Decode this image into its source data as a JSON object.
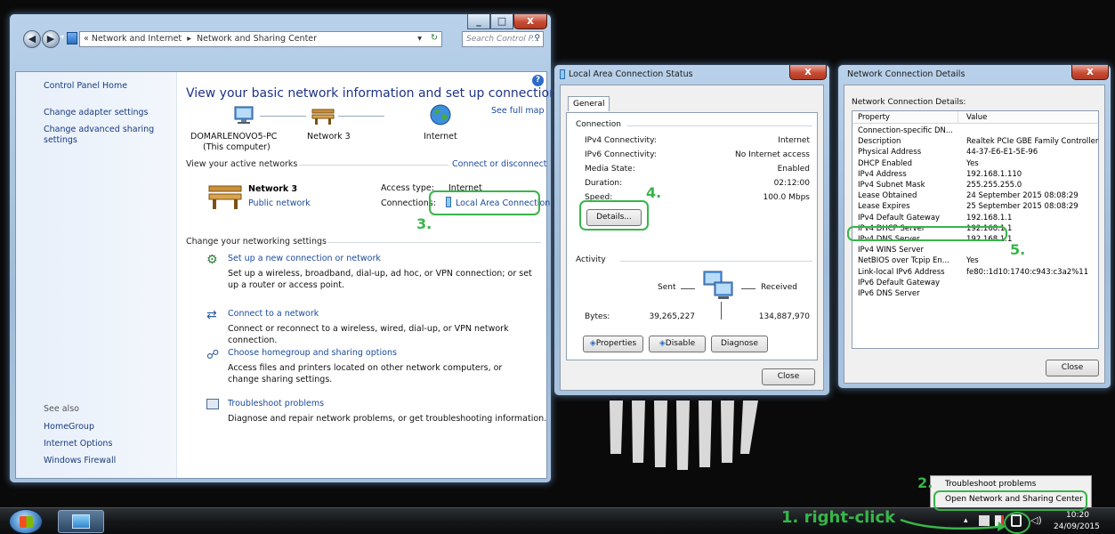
{
  "nsc": {
    "breadcrumb_prefix": "«",
    "crumb_1": "Network and Internet",
    "crumb_sep": "▸",
    "crumb_2": "Network and Sharing Center",
    "search_placeholder": "Search Control P...",
    "sidebar_home": "Control Panel Home",
    "sidebar_links": [
      "Change adapter settings",
      "Change advanced sharing settings"
    ],
    "see_also_label": "See also",
    "see_also_links": [
      "HomeGroup",
      "Internet Options",
      "Windows Firewall"
    ],
    "title": "View your basic network information and set up connections",
    "see_full_map": "See full map",
    "map_computer": "DOMARLENOVO5-PC",
    "map_computer_sub": "(This computer)",
    "map_network": "Network 3",
    "map_internet": "Internet",
    "active_networks_label": "View your active networks",
    "connect_disconnect": "Connect or disconnect",
    "network_name": "Network 3",
    "network_type": "Public network",
    "access_type_label": "Access type:",
    "access_type_value": "Internet",
    "connections_label": "Connections:",
    "connections_value": "Local Area Connection",
    "change_settings_label": "Change your networking settings",
    "tasks": [
      {
        "title": "Set up a new connection or network",
        "desc": "Set up a wireless, broadband, dial-up, ad hoc, or VPN connection; or set up a router or access point."
      },
      {
        "title": "Connect to a network",
        "desc": "Connect or reconnect to a wireless, wired, dial-up, or VPN network connection."
      },
      {
        "title": "Choose homegroup and sharing options",
        "desc": "Access files and printers located on other network computers, or change sharing settings."
      },
      {
        "title": "Troubleshoot problems",
        "desc": "Diagnose and repair network problems, or get troubleshooting information."
      }
    ]
  },
  "status": {
    "title": "Local Area Connection Status",
    "tab": "General",
    "connection_group": "Connection",
    "rows": [
      {
        "label": "IPv4 Connectivity:",
        "value": "Internet"
      },
      {
        "label": "IPv6 Connectivity:",
        "value": "No Internet access"
      },
      {
        "label": "Media State:",
        "value": "Enabled"
      },
      {
        "label": "Duration:",
        "value": "02:12:00"
      },
      {
        "label": "Speed:",
        "value": "100.0 Mbps"
      }
    ],
    "details_button": "Details...",
    "activity_group": "Activity",
    "sent_label": "Sent",
    "received_label": "Received",
    "bytes_label": "Bytes:",
    "bytes_sent": "39,265,227",
    "bytes_received": "134,887,970",
    "properties_button": "Properties",
    "disable_button": "Disable",
    "diagnose_button": "Diagnose",
    "close_button": "Close"
  },
  "details": {
    "title": "Network Connection Details",
    "group_label": "Network Connection Details:",
    "col_property": "Property",
    "col_value": "Value",
    "rows": [
      {
        "p": "Connection-specific DN...",
        "v": ""
      },
      {
        "p": "Description",
        "v": "Realtek PCIe GBE Family Controller"
      },
      {
        "p": "Physical Address",
        "v": "44-37-E6-E1-5E-96"
      },
      {
        "p": "DHCP Enabled",
        "v": "Yes"
      },
      {
        "p": "IPv4 Address",
        "v": "192.168.1.110"
      },
      {
        "p": "IPv4 Subnet Mask",
        "v": "255.255.255.0"
      },
      {
        "p": "Lease Obtained",
        "v": "24 September 2015 08:08:29"
      },
      {
        "p": "Lease Expires",
        "v": "25 September 2015 08:08:29"
      },
      {
        "p": "IPv4 Default Gateway",
        "v": "192.168.1.1"
      },
      {
        "p": "IPv4 DHCP Server",
        "v": "192.168.1.1"
      },
      {
        "p": "IPv4 DNS Server",
        "v": "192.168.1.1"
      },
      {
        "p": "IPv4 WINS Server",
        "v": ""
      },
      {
        "p": "NetBIOS over Tcpip En...",
        "v": "Yes"
      },
      {
        "p": "Link-local IPv6 Address",
        "v": "fe80::1d10:1740:c943:c3a2%11"
      },
      {
        "p": "IPv6 Default Gateway",
        "v": ""
      },
      {
        "p": "IPv6 DNS Server",
        "v": ""
      }
    ],
    "close_button": "Close"
  },
  "context_menu": {
    "items": [
      "Troubleshoot problems",
      "Open Network and Sharing Center"
    ]
  },
  "taskbar": {
    "time": "10:20",
    "date": "24/09/2015"
  },
  "annotations": {
    "step1": "1. right-click",
    "step2": "2.",
    "step3": "3.",
    "step4": "4.",
    "step5": "5."
  },
  "colors": {
    "highlight": "#38b54a",
    "link": "#1a4a9c",
    "heading": "#1e3287"
  }
}
